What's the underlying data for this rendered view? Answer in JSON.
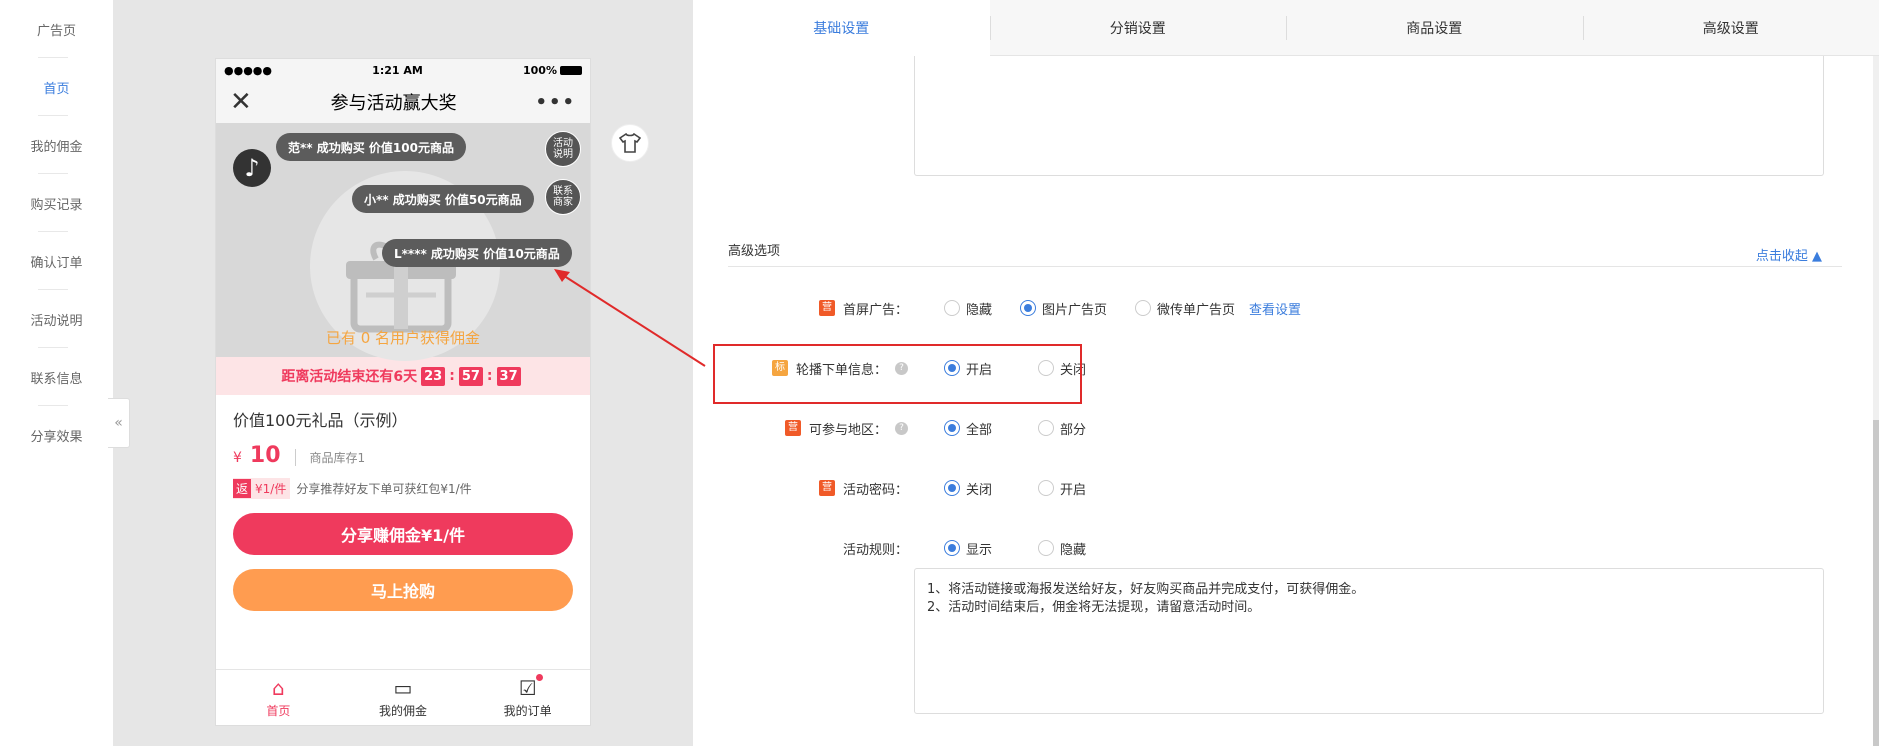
{
  "leftnav": {
    "items": [
      "广告页",
      "首页",
      "我的佣金",
      "购买记录",
      "确认订单",
      "活动说明",
      "联系信息",
      "分享效果"
    ],
    "active_index": 1
  },
  "collapse_glyph": "«",
  "phone": {
    "status": {
      "signal": "●●●●●",
      "time": "1:21 AM",
      "battery": "100%"
    },
    "title": "参与活动赢大奖",
    "close_glyph": "✕",
    "more_glyph": "•••",
    "bubbles": [
      "范** 成功购买 价值100元商品",
      "小** 成功购买 价值50元商品",
      "L**** 成功购买 价值10元商品"
    ],
    "side_buttons": {
      "rules": "活动\n说明",
      "contact": "联系\n商家"
    },
    "joined_text": "已有 0 名用户获得佣金",
    "countdown": {
      "label": "距离活动结束还有6天",
      "h": "23",
      "m": "57",
      "s": "37"
    },
    "product": {
      "name": "价值100元礼品（示例）",
      "currency": "¥",
      "price": "10",
      "stock": "商品库存1",
      "rebate_tag_icon": "返",
      "rebate_tag": "¥1/件",
      "rebate_text": "分享推荐好友下单可获红包¥1/件"
    },
    "share_button": "分享赚佣金¥1/件",
    "buy_button": "马上抢购",
    "footer_tabs": [
      "首页",
      "我的佣金",
      "我的订单"
    ]
  },
  "tabs": [
    "基础设置",
    "分销设置",
    "商品设置",
    "高级设置"
  ],
  "active_tab": 0,
  "advanced": {
    "title": "高级选项",
    "collapse_link": "点击收起 ▲",
    "rows": [
      {
        "icon": "营",
        "label": "首屏广告：",
        "help": false,
        "options": [
          "隐藏",
          "图片广告页",
          "微传单广告页"
        ],
        "selected": 1,
        "link": "查看设置"
      },
      {
        "icon": "标",
        "label": "轮播下单信息：",
        "help": true,
        "options": [
          "开启",
          "关闭"
        ],
        "selected": 0
      },
      {
        "icon": "营",
        "label": "可参与地区：",
        "help": true,
        "options": [
          "全部",
          "部分"
        ],
        "selected": 0
      },
      {
        "icon": "营",
        "label": "活动密码：",
        "help": false,
        "options": [
          "关闭",
          "开启"
        ],
        "selected": 0
      },
      {
        "icon": "",
        "label": "活动规则：",
        "help": false,
        "options": [
          "显示",
          "隐藏"
        ],
        "selected": 0
      }
    ],
    "rules_lines": [
      "1、将活动链接或海报发送给好友，好友购买商品并完成支付，可获得佣金。",
      "2、活动时间结束后，佣金将无法提现，请留意活动时间。"
    ]
  },
  "colors": {
    "accent": "#3b7ddd",
    "brand_red": "#ef3a5d",
    "orange": "#ff9c50",
    "highlight_box": "#e02a2a"
  }
}
